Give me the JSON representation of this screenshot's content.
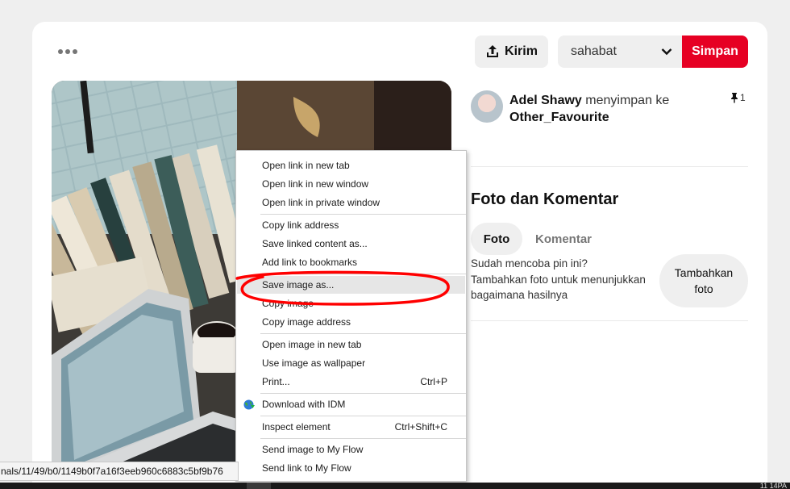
{
  "header": {
    "send_label": "Kirim",
    "board_value": "sahabat",
    "save_label": "Simpan"
  },
  "saver": {
    "name": "Adel Shawy",
    "action": " menyimpan ke",
    "board": "Other_Favourite",
    "pin_count": "1"
  },
  "comments": {
    "title": "Foto dan Komentar",
    "tab_photo": "Foto",
    "tab_comment": "Komentar",
    "try_line1": "Sudah mencoba pin ini?",
    "try_line2": "Tambahkan foto untuk menunjukkan bagaimana hasilnya",
    "add_photo_line1": "Tambahkan",
    "add_photo_line2": "foto"
  },
  "context_menu": {
    "open_new_tab": "Open link in new tab",
    "open_new_window": "Open link in new window",
    "open_private": "Open link in private window",
    "copy_link": "Copy link address",
    "save_linked": "Save linked content as...",
    "add_bookmark": "Add link to bookmarks",
    "save_image": "Save image as...",
    "copy_image": "Copy image",
    "copy_image_address": "Copy image address",
    "open_image_tab": "Open image in new tab",
    "use_wallpaper": "Use image as wallpaper",
    "print": "Print...",
    "print_shortcut": "Ctrl+P",
    "download_idm": "Download with IDM",
    "inspect": "Inspect element",
    "inspect_shortcut": "Ctrl+Shift+C",
    "send_image_flow": "Send image to My Flow",
    "send_link_flow": "Send link to My Flow"
  },
  "statusbar": {
    "url": "nals/11/49/b0/1149b0f7a16f3eeb960c6883c5bf9b76"
  },
  "taskbar": {
    "right_text": "11  14PA"
  },
  "colors": {
    "brand": "#e60023",
    "highlight": "#e6e6e6",
    "annotation": "#ff0000"
  }
}
